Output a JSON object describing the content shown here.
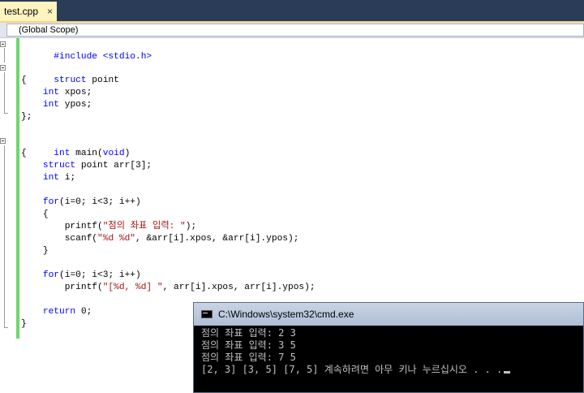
{
  "tab": {
    "label": "test.cpp",
    "close": "×"
  },
  "scope": {
    "value": "(Global Scope)"
  },
  "code": {
    "l1": "#include <stdio.h>",
    "l3a": "struct",
    "l3b": " point",
    "l4": "{",
    "l5a": "int",
    "l5b": " xpos;",
    "l6a": "int",
    "l6b": " ypos;",
    "l7": "};",
    "l9a": "int",
    "l9b": " main(",
    "l9c": "void",
    "l9d": ")",
    "l10": "{",
    "l11a": "struct",
    "l11b": " point arr[3];",
    "l12a": "int",
    "l12b": " i;",
    "l14a": "for",
    "l14b": "(i=0; i<3; i++)",
    "l15": "{",
    "l16a": "printf(",
    "l16b": "\"점의 좌표 입력: \"",
    "l16c": ");",
    "l17a": "scanf(",
    "l17b": "\"%d %d\"",
    "l17c": ", &arr[i].xpos, &arr[i].ypos);",
    "l18": "}",
    "l20a": "for",
    "l20b": "(i=0; i<3; i++)",
    "l21a": "printf(",
    "l21b": "\"[%d, %d] \"",
    "l21c": ", arr[i].xpos, arr[i].ypos);",
    "l23a": "return",
    "l23b": " 0;",
    "l24": "}"
  },
  "console": {
    "title": "C:\\Windows\\system32\\cmd.exe",
    "lines": [
      "점의 좌표 입력: 2 3",
      "점의 좌표 입력: 3 5",
      "점의 좌표 입력: 7 5",
      "[2, 3] [3, 5] [7, 5] 계속하려면 아무 키나 누르십시오 . . ."
    ]
  },
  "colors": {
    "keyword": "#0000ff",
    "string": "#a31515",
    "change_bar": "#6bd96b",
    "tab_active": "#fdf4bf"
  }
}
